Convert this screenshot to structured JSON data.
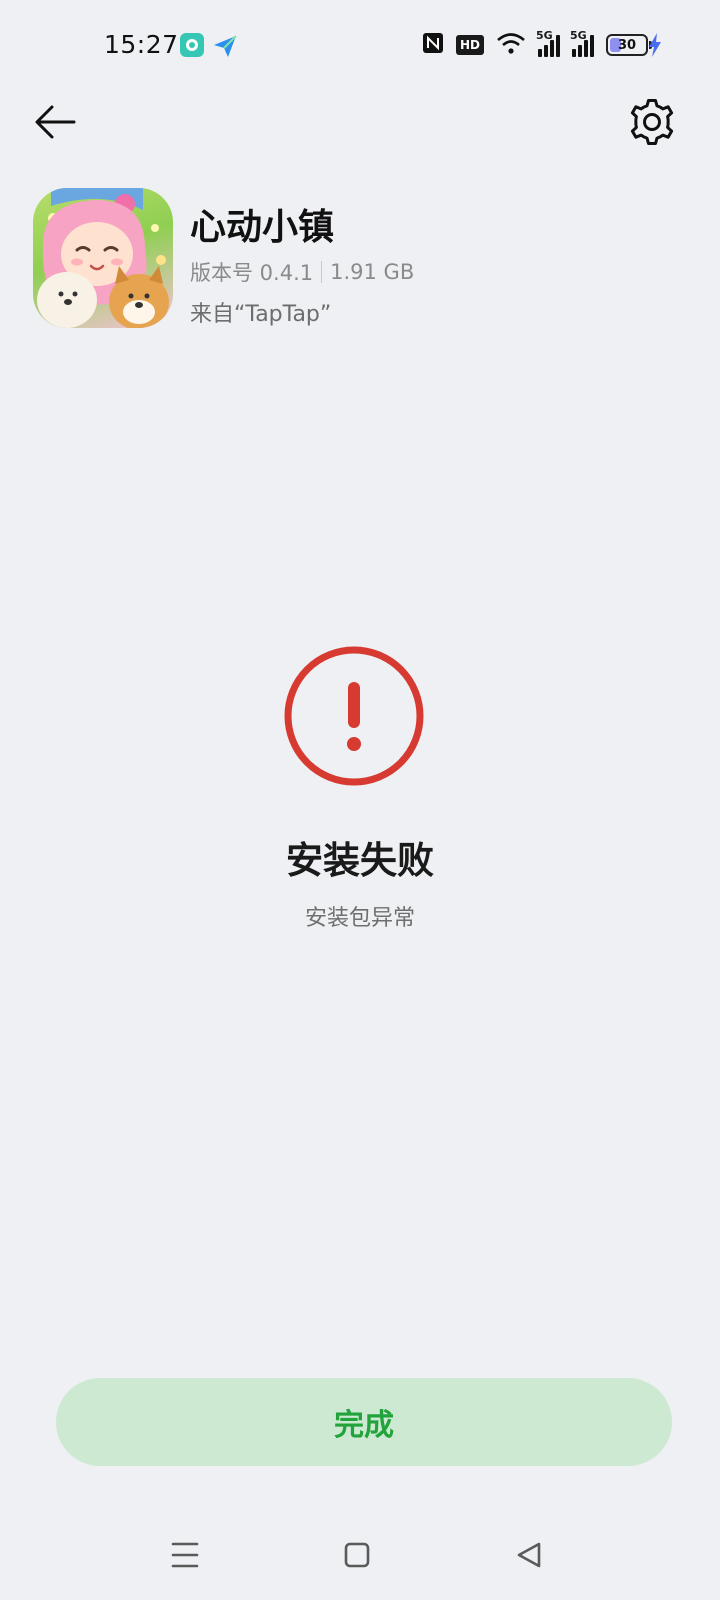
{
  "status_bar": {
    "time": "15:27",
    "hd_badge": "HD",
    "network_1": "5G",
    "network_2": "5G",
    "battery_level": "30",
    "icons": [
      "nfc-icon",
      "hd-icon",
      "wifi-icon",
      "signal-5g-icon",
      "signal-5g-icon",
      "battery-icon",
      "charging-icon"
    ]
  },
  "toolbar": {
    "back_icon": "back-arrow-icon",
    "settings_icon": "gear-icon"
  },
  "app": {
    "name": "心动小镇",
    "version_label": "版本号 0.4.1",
    "size": "1.91 GB",
    "source": "来自“TapTap”"
  },
  "result": {
    "icon": "error-icon",
    "status_color": "#d63a30",
    "title": "安装失败",
    "subtitle": "安装包异常"
  },
  "actions": {
    "done_label": "完成",
    "accent_color": "#22a33c"
  },
  "nav_bar": {
    "icons": [
      "menu-icon",
      "home-icon",
      "back-icon"
    ]
  }
}
